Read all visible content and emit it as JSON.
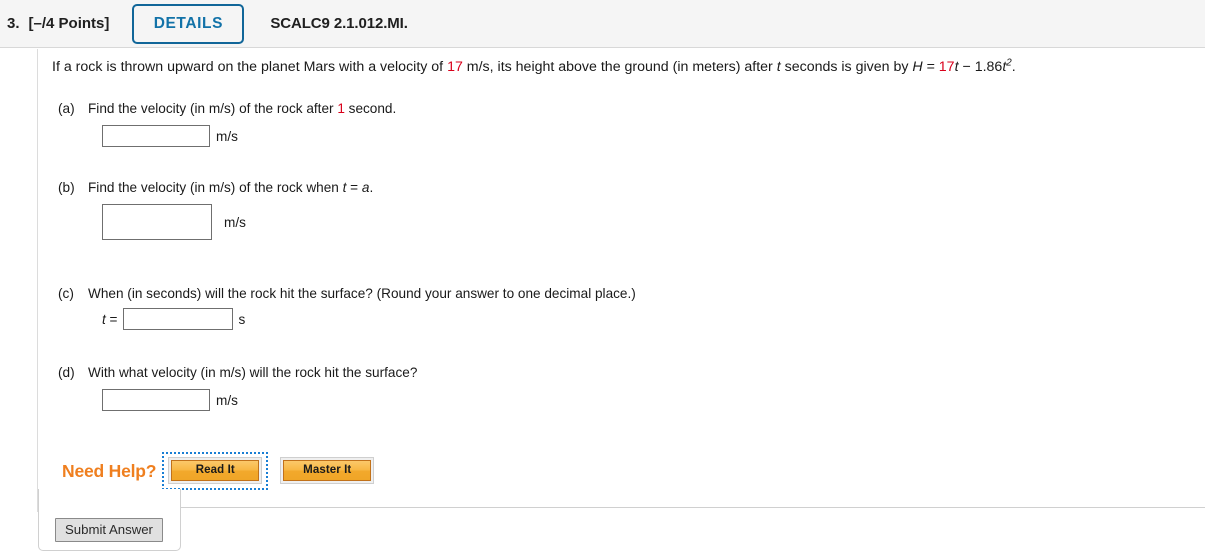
{
  "header": {
    "question_number": "3.",
    "points": "[–/4 Points]",
    "details_label": "DETAILS",
    "assignment_code": "SCALC9 2.1.012.MI."
  },
  "problem": {
    "text_part1": "If a rock is thrown upward on the planet Mars with a velocity of ",
    "velocity_value": "17",
    "text_part2": " m/s, its height above the ground (in meters) after ",
    "var_t": "t",
    "text_part3": " seconds is given by ",
    "formula_H": "H",
    "formula_eq": " = ",
    "formula_coeff": "17",
    "formula_t1": "t",
    "formula_minus": " − ",
    "formula_coeff2": "1.86",
    "formula_t2": "t",
    "formula_exp": "2",
    "formula_period": "."
  },
  "parts": [
    {
      "letter": "(a)",
      "text_before": "Find the velocity (in m/s) of the rock after ",
      "highlight": "1",
      "text_after": " second.",
      "input_value": "",
      "unit": "m/s"
    },
    {
      "letter": "(b)",
      "text_before": "Find the velocity (in m/s) of the rock when ",
      "var_t": "t",
      "eq": " = ",
      "var_a": "a",
      "text_after": ".",
      "input_value": "",
      "unit": "m/s"
    },
    {
      "letter": "(c)",
      "text_before": "When (in seconds) will the rock hit the surface? (Round your answer to one decimal place.)",
      "prefix": "t",
      "prefix_eq": " =",
      "input_value": "",
      "unit": "s"
    },
    {
      "letter": "(d)",
      "text_before": "With what velocity (in m/s) will the rock hit the surface?",
      "input_value": "",
      "unit": "m/s"
    }
  ],
  "help": {
    "label": "Need Help?",
    "read_it_label": "Read It",
    "master_it_label": "Master It"
  },
  "footer": {
    "submit_label": "Submit Answer"
  },
  "colors": {
    "accent_blue": "#116699",
    "highlight_red": "#d9001b",
    "help_orange": "#ef7f1f",
    "focus_blue": "#1a7fd4"
  }
}
